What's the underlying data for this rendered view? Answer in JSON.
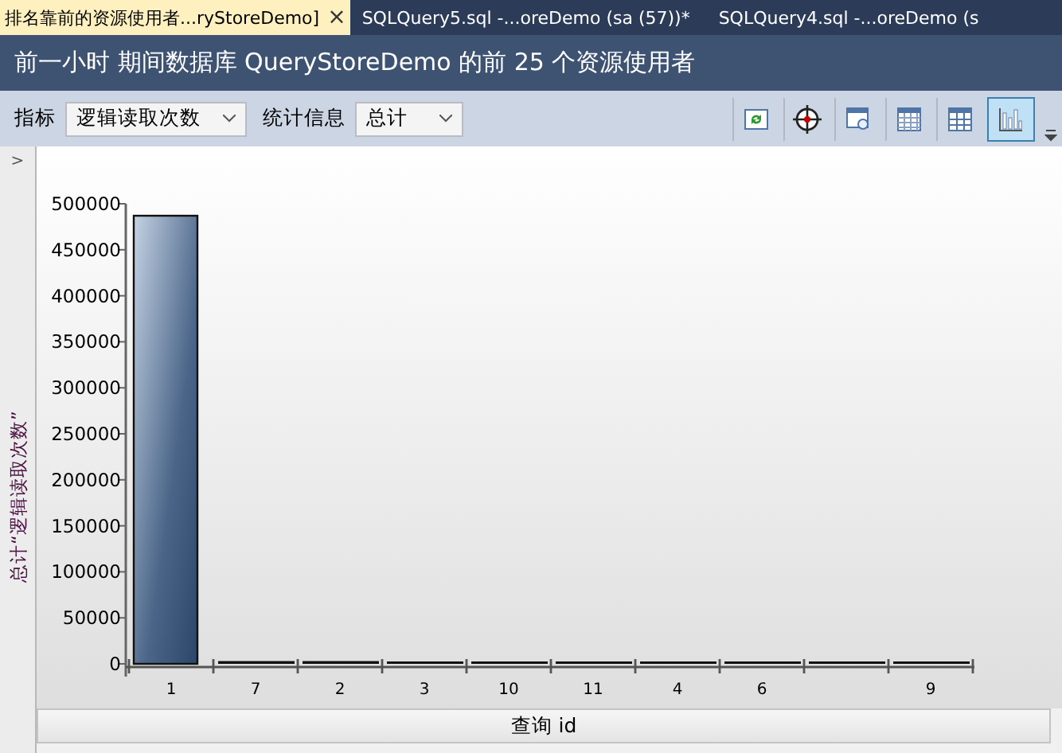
{
  "tabs": [
    {
      "label": "排名靠前的资源使用者...ryStoreDemo]",
      "selected": true,
      "close": "×"
    },
    {
      "label": "SQLQuery5.sql -...oreDemo (sa (57))*",
      "selected": false
    },
    {
      "label": "SQLQuery4.sql -...oreDemo (s",
      "selected": false
    }
  ],
  "title": "前一小时 期间数据库 QueryStoreDemo 的前 25 个资源使用者",
  "toolbar": {
    "metric_label": "指标",
    "metric_value": "逻辑读取次数",
    "stat_label": "统计信息",
    "stat_value": "总计",
    "buttons": [
      {
        "kind": "refresh",
        "selected": false
      },
      {
        "kind": "target",
        "selected": false
      },
      {
        "kind": "window",
        "selected": false
      },
      {
        "kind": "grid",
        "selected": false
      },
      {
        "kind": "table",
        "selected": false
      },
      {
        "kind": "chart",
        "selected": true
      }
    ]
  },
  "sidebar": {
    "toggle": ">"
  },
  "chart": {
    "chart_data": {
      "type": "bar",
      "xlabel": "查询 id",
      "ylabel": "总计“逻辑读取次数”",
      "categories": [
        "1",
        "7",
        "2",
        "3",
        "10",
        "11",
        "4",
        "6",
        null,
        "9"
      ],
      "values": [
        487000,
        3000,
        3000,
        1000,
        1000,
        1000,
        1000,
        1000,
        1000,
        1000
      ],
      "ylim": [
        0,
        500000
      ],
      "yticks": [
        0,
        50000,
        100000,
        150000,
        200000,
        250000,
        300000,
        350000,
        400000,
        450000,
        500000
      ]
    }
  }
}
